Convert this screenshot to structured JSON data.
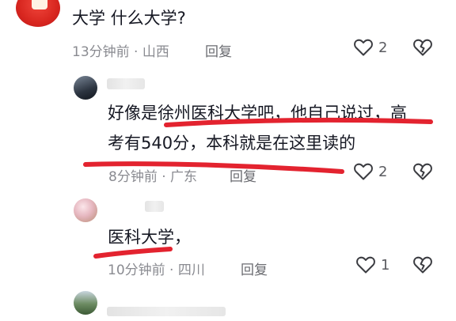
{
  "comments": [
    {
      "text": "大学  什么大学?",
      "meta": "13分钟前 · 山西",
      "reply_label": "回复",
      "likes": "2"
    },
    {
      "text_line1": "好像是徐州医科大学吧，他自己说过，高",
      "text_line2": "考有540分，本科就是在这里读的",
      "meta": "8分钟前 · 广东",
      "reply_label": "回复",
      "likes": "2"
    },
    {
      "text": "医科大学，",
      "meta": "10分钟前 · 四川",
      "reply_label": "回复",
      "likes": "1"
    }
  ],
  "icons": {
    "like": "heart-outline-icon",
    "dislike": "broken-heart-icon"
  },
  "colors": {
    "annotation": "#e3232f",
    "meta_text": "#8a8b91"
  }
}
